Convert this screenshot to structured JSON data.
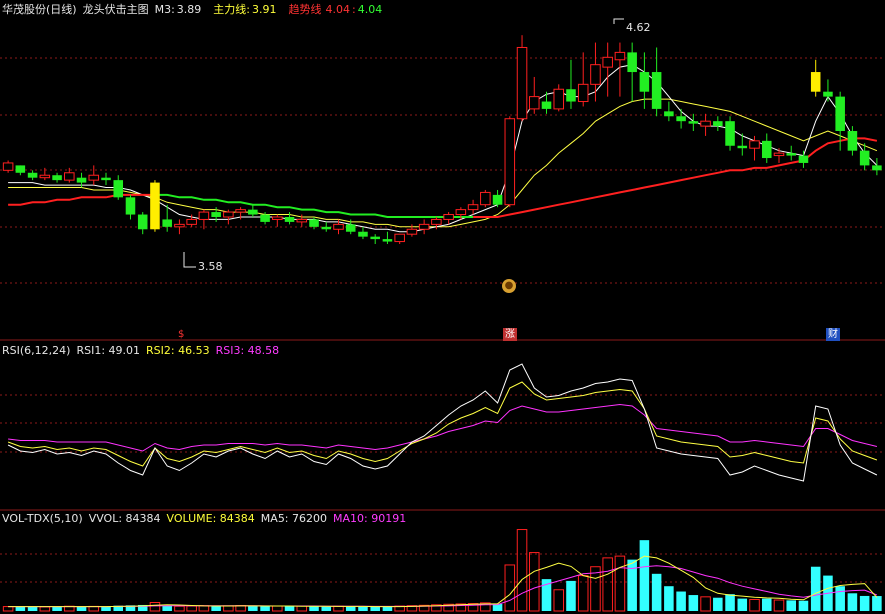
{
  "header": {
    "stock": "华茂股份(日线)",
    "indicator": "龙头伏击主图",
    "m3_label": "M3:",
    "m3_value": "3.89",
    "main_label": "主力线:",
    "main_value": "3.91",
    "trend_label": "趋势线",
    "trend_value1": "4.04",
    "trend_value2": "4.04"
  },
  "rsi_header": {
    "name": "RSI(6,12,24)",
    "rsi1": "RSI1: 49.01",
    "rsi2": "RSI2: 46.53",
    "rsi3": "RSI3: 48.58"
  },
  "vol_header": {
    "name": "VOL-TDX(5,10)",
    "vvol": "VVOL: 84384",
    "volume": "VOLUME: 84384",
    "ma5": "MA5: 76200",
    "ma10": "MA10: 90191"
  },
  "annotations": {
    "high_label": "4.62",
    "low_label": "3.58",
    "marker_s": "$",
    "marker_zhang": "涨",
    "marker_cai": "财"
  },
  "colors": {
    "background": "#000000",
    "up": "#ff2020",
    "down": "#22ee22",
    "highlight": "#ffee00",
    "grid": "#8b1a1a",
    "ma_white": "#ffffff",
    "ma_yellow": "#ffff44",
    "trend_red": "#ff2020",
    "trend_green": "#22ee22",
    "rsi1": "#ffffff",
    "rsi2": "#ffff44",
    "rsi3": "#ff33ff",
    "vol_up_fill": "#33ffff",
    "vol_down_fill": "#33ffff"
  },
  "chart_data": {
    "type": "candlestick",
    "price_range": [
      3.45,
      4.72
    ],
    "candles": [
      [
        4.1,
        4.14,
        4.09,
        4.13
      ],
      [
        4.12,
        4.12,
        4.08,
        4.09
      ],
      [
        4.09,
        4.1,
        4.06,
        4.07
      ],
      [
        4.07,
        4.11,
        4.06,
        4.08
      ],
      [
        4.08,
        4.09,
        4.05,
        4.06
      ],
      [
        4.06,
        4.11,
        4.05,
        4.09
      ],
      [
        4.07,
        4.09,
        4.03,
        4.05
      ],
      [
        4.06,
        4.12,
        4.04,
        4.08
      ],
      [
        4.07,
        4.09,
        4.04,
        4.06
      ],
      [
        4.06,
        4.08,
        3.98,
        3.99
      ],
      [
        3.99,
        4.0,
        3.9,
        3.92
      ],
      [
        3.92,
        3.93,
        3.84,
        3.86
      ],
      [
        3.86,
        4.06,
        3.85,
        4.05
      ],
      [
        3.9,
        3.96,
        3.85,
        3.87
      ],
      [
        3.87,
        3.9,
        3.84,
        3.88
      ],
      [
        3.88,
        3.92,
        3.87,
        3.9
      ],
      [
        3.9,
        3.94,
        3.86,
        3.93
      ],
      [
        3.93,
        3.95,
        3.89,
        3.91
      ],
      [
        3.91,
        3.94,
        3.88,
        3.93
      ],
      [
        3.93,
        3.95,
        3.9,
        3.94
      ],
      [
        3.94,
        3.96,
        3.91,
        3.92
      ],
      [
        3.92,
        3.93,
        3.88,
        3.89
      ],
      [
        3.9,
        3.92,
        3.87,
        3.91
      ],
      [
        3.91,
        3.93,
        3.88,
        3.89
      ],
      [
        3.89,
        3.92,
        3.87,
        3.9
      ],
      [
        3.9,
        3.91,
        3.86,
        3.87
      ],
      [
        3.87,
        3.89,
        3.85,
        3.86
      ],
      [
        3.86,
        3.9,
        3.84,
        3.88
      ],
      [
        3.88,
        3.9,
        3.84,
        3.85
      ],
      [
        3.85,
        3.87,
        3.82,
        3.83
      ],
      [
        3.83,
        3.84,
        3.8,
        3.82
      ],
      [
        3.82,
        3.85,
        3.8,
        3.81
      ],
      [
        3.81,
        3.84,
        3.8,
        3.84
      ],
      [
        3.84,
        3.88,
        3.83,
        3.86
      ],
      [
        3.86,
        3.9,
        3.84,
        3.88
      ],
      [
        3.88,
        3.91,
        3.86,
        3.9
      ],
      [
        3.9,
        3.93,
        3.88,
        3.92
      ],
      [
        3.92,
        3.95,
        3.9,
        3.94
      ],
      [
        3.94,
        3.98,
        3.92,
        3.96
      ],
      [
        3.96,
        4.02,
        3.95,
        4.01
      ],
      [
        4.0,
        4.02,
        3.95,
        3.96
      ],
      [
        3.96,
        4.32,
        3.95,
        4.31
      ],
      [
        4.31,
        4.65,
        4.3,
        4.6
      ],
      [
        4.35,
        4.48,
        4.33,
        4.4
      ],
      [
        4.38,
        4.42,
        4.33,
        4.35
      ],
      [
        4.35,
        4.45,
        4.34,
        4.43
      ],
      [
        4.43,
        4.55,
        4.35,
        4.38
      ],
      [
        4.38,
        4.58,
        4.36,
        4.45
      ],
      [
        4.45,
        4.62,
        4.38,
        4.53
      ],
      [
        4.52,
        4.62,
        4.4,
        4.56
      ],
      [
        4.55,
        4.62,
        4.4,
        4.58
      ],
      [
        4.58,
        4.62,
        4.38,
        4.5
      ],
      [
        4.5,
        4.58,
        4.35,
        4.42
      ],
      [
        4.5,
        4.6,
        4.32,
        4.35
      ],
      [
        4.34,
        4.38,
        4.3,
        4.32
      ],
      [
        4.32,
        4.35,
        4.27,
        4.3
      ],
      [
        4.3,
        4.33,
        4.26,
        4.29
      ],
      [
        4.28,
        4.33,
        4.24,
        4.3
      ],
      [
        4.3,
        4.32,
        4.26,
        4.28
      ],
      [
        4.3,
        4.32,
        4.18,
        4.2
      ],
      [
        4.2,
        4.25,
        4.16,
        4.19
      ],
      [
        4.19,
        4.24,
        4.14,
        4.22
      ],
      [
        4.22,
        4.25,
        4.13,
        4.15
      ],
      [
        4.16,
        4.19,
        4.13,
        4.17
      ],
      [
        4.17,
        4.2,
        4.14,
        4.16
      ],
      [
        4.16,
        4.18,
        4.11,
        4.13
      ],
      [
        4.5,
        4.55,
        4.4,
        4.42
      ],
      [
        4.42,
        4.47,
        4.38,
        4.4
      ],
      [
        4.4,
        4.42,
        4.18,
        4.26
      ],
      [
        4.26,
        4.28,
        4.16,
        4.18
      ],
      [
        4.18,
        4.21,
        4.1,
        4.12
      ],
      [
        4.12,
        4.15,
        4.08,
        4.1
      ]
    ],
    "highlight_candles": [
      12,
      66
    ],
    "ma_white": [
      4.05,
      4.05,
      4.05,
      4.04,
      4.04,
      4.04,
      4.04,
      4.04,
      4.03,
      4.03,
      4.02,
      4.0,
      3.98,
      3.95,
      3.92,
      3.91,
      3.9,
      3.9,
      3.9,
      3.91,
      3.91,
      3.91,
      3.91,
      3.9,
      3.9,
      3.9,
      3.89,
      3.89,
      3.88,
      3.87,
      3.86,
      3.86,
      3.85,
      3.85,
      3.86,
      3.87,
      3.88,
      3.9,
      3.92,
      3.94,
      3.96,
      4.1,
      4.3,
      4.38,
      4.41,
      4.42,
      4.4,
      4.4,
      4.42,
      4.48,
      4.52,
      4.53,
      4.5,
      4.46,
      4.4,
      4.34,
      4.3,
      4.28,
      4.28,
      4.27,
      4.24,
      4.22,
      4.2,
      4.18,
      4.17,
      4.16,
      4.3,
      4.4,
      4.33,
      4.24,
      4.17,
      4.12
    ],
    "ma_yellow": [
      4.03,
      4.03,
      4.03,
      4.03,
      4.03,
      4.03,
      4.03,
      4.02,
      4.02,
      4.02,
      4.01,
      4.0,
      3.99,
      3.97,
      3.96,
      3.95,
      3.94,
      3.94,
      3.93,
      3.93,
      3.93,
      3.92,
      3.92,
      3.92,
      3.91,
      3.91,
      3.9,
      3.9,
      3.89,
      3.89,
      3.88,
      3.88,
      3.87,
      3.87,
      3.87,
      3.87,
      3.87,
      3.88,
      3.89,
      3.9,
      3.92,
      3.96,
      4.02,
      4.08,
      4.12,
      4.17,
      4.21,
      4.25,
      4.3,
      4.33,
      4.36,
      4.38,
      4.39,
      4.39,
      4.39,
      4.38,
      4.37,
      4.36,
      4.35,
      4.34,
      4.32,
      4.3,
      4.28,
      4.26,
      4.24,
      4.22,
      4.24,
      4.26,
      4.24,
      4.22,
      4.2,
      4.18
    ],
    "trend_line": [
      3.96,
      3.96,
      3.97,
      3.97,
      3.98,
      3.98,
      3.99,
      3.99,
      3.99,
      4.0,
      4.0,
      4.0,
      4.0,
      4.0,
      3.99,
      3.99,
      3.98,
      3.98,
      3.97,
      3.97,
      3.96,
      3.96,
      3.95,
      3.95,
      3.94,
      3.94,
      3.93,
      3.93,
      3.92,
      3.92,
      3.92,
      3.91,
      3.91,
      3.91,
      3.91,
      3.91,
      3.91,
      3.91,
      3.91,
      3.91,
      3.91,
      3.92,
      3.93,
      3.94,
      3.95,
      3.96,
      3.97,
      3.98,
      3.99,
      4.0,
      4.01,
      4.02,
      4.03,
      4.04,
      4.05,
      4.06,
      4.07,
      4.08,
      4.09,
      4.1,
      4.1,
      4.11,
      4.11,
      4.12,
      4.13,
      4.14,
      4.18,
      4.21,
      4.22,
      4.23,
      4.23,
      4.22
    ],
    "trend_green_range": [
      12,
      38
    ],
    "rsi_range": [
      0,
      100
    ],
    "rsi1": [
      42,
      38,
      37,
      39,
      36,
      37,
      35,
      38,
      36,
      30,
      25,
      22,
      40,
      28,
      25,
      30,
      36,
      34,
      38,
      40,
      36,
      33,
      38,
      34,
      36,
      31,
      29,
      36,
      33,
      28,
      26,
      28,
      36,
      44,
      48,
      55,
      62,
      68,
      72,
      78,
      70,
      92,
      96,
      80,
      74,
      75,
      78,
      80,
      83,
      84,
      86,
      85,
      66,
      40,
      38,
      36,
      35,
      34,
      33,
      22,
      24,
      28,
      25,
      22,
      20,
      18,
      68,
      66,
      42,
      30,
      26,
      22
    ],
    "rsi2": [
      44,
      41,
      40,
      41,
      39,
      40,
      38,
      40,
      39,
      35,
      31,
      28,
      40,
      33,
      31,
      34,
      38,
      37,
      39,
      41,
      39,
      37,
      40,
      37,
      38,
      35,
      33,
      38,
      36,
      33,
      31,
      33,
      38,
      43,
      46,
      50,
      56,
      60,
      63,
      67,
      63,
      80,
      84,
      76,
      72,
      73,
      74,
      75,
      77,
      78,
      79,
      78,
      66,
      48,
      46,
      44,
      43,
      42,
      41,
      34,
      35,
      37,
      35,
      33,
      31,
      30,
      60,
      58,
      46,
      38,
      35,
      32
    ],
    "rsi3": [
      46,
      45,
      45,
      45,
      44,
      44,
      44,
      44,
      44,
      42,
      40,
      38,
      43,
      40,
      39,
      41,
      42,
      42,
      43,
      43,
      43,
      42,
      43,
      42,
      42,
      41,
      40,
      42,
      41,
      40,
      39,
      40,
      42,
      44,
      46,
      48,
      51,
      53,
      55,
      58,
      57,
      65,
      68,
      66,
      64,
      64,
      65,
      66,
      67,
      68,
      69,
      68,
      62,
      53,
      52,
      51,
      50,
      49,
      48,
      44,
      44,
      45,
      44,
      43,
      42,
      41,
      53,
      53,
      49,
      45,
      43,
      41
    ],
    "vol_range": [
      0,
      480000
    ],
    "volume": [
      25000,
      26000,
      24000,
      23000,
      25000,
      27000,
      24000,
      26000,
      25000,
      30000,
      32000,
      34000,
      48000,
      30000,
      27000,
      28000,
      30000,
      27000,
      29000,
      31000,
      28000,
      26000,
      28000,
      27000,
      28000,
      26000,
      25000,
      27000,
      26000,
      24000,
      23000,
      25000,
      28000,
      30000,
      32000,
      35000,
      38000,
      40000,
      42000,
      46000,
      40000,
      260000,
      460000,
      330000,
      180000,
      120000,
      170000,
      200000,
      250000,
      300000,
      310000,
      290000,
      400000,
      210000,
      140000,
      110000,
      90000,
      80000,
      75000,
      95000,
      70000,
      65000,
      70000,
      62000,
      60000,
      58000,
      250000,
      200000,
      140000,
      100000,
      85000,
      84384
    ],
    "vol_ma5": [
      25000,
      25000,
      25000,
      25000,
      25000,
      25000,
      25000,
      25000,
      25000,
      26000,
      27000,
      29000,
      33000,
      35000,
      34000,
      31000,
      29000,
      28000,
      28000,
      29000,
      29000,
      28000,
      28000,
      28000,
      27000,
      27000,
      27000,
      26000,
      26000,
      26000,
      25000,
      25000,
      25000,
      26000,
      28000,
      30000,
      33000,
      35000,
      38000,
      40000,
      41000,
      93000,
      178000,
      224000,
      246000,
      270000,
      252000,
      200000,
      184000,
      208000,
      246000,
      270000,
      310000,
      300000,
      270000,
      230000,
      190000,
      130000,
      100000,
      90000,
      84000,
      78000,
      74000,
      72000,
      66000,
      63000,
      100000,
      128000,
      144000,
      150000,
      155000,
      76200
    ],
    "vol_ma10": [
      25000,
      25000,
      25000,
      25000,
      25000,
      25000,
      25000,
      25000,
      25000,
      26000,
      26000,
      27000,
      29000,
      30000,
      30000,
      30000,
      30000,
      30000,
      30000,
      30000,
      30000,
      29000,
      28000,
      28000,
      28000,
      28000,
      27000,
      27000,
      27000,
      27000,
      26000,
      26000,
      26000,
      26000,
      27000,
      28000,
      29000,
      31000,
      33000,
      35000,
      36000,
      60000,
      100000,
      130000,
      150000,
      170000,
      190000,
      210000,
      215000,
      225000,
      245000,
      240000,
      250000,
      255000,
      250000,
      240000,
      220000,
      200000,
      185000,
      160000,
      140000,
      125000,
      110000,
      95000,
      85000,
      78000,
      90000,
      100000,
      110000,
      115000,
      118000,
      90191
    ]
  }
}
